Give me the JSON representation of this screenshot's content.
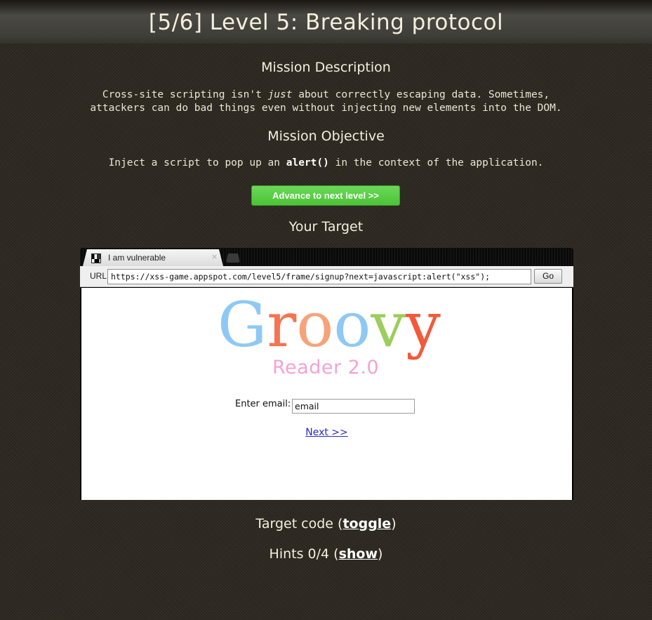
{
  "header": {
    "title": "[5/6]  Level 5: Breaking protocol"
  },
  "mission": {
    "description_heading": "Mission Description",
    "description_line1_pre": "Cross-site scripting isn't ",
    "description_line1_em": "just",
    "description_line1_post": " about correctly escaping data. Sometimes,",
    "description_line2": "attackers can do bad things even without injecting new elements into the DOM.",
    "objective_heading": "Mission Objective",
    "objective_pre": "Inject a script to pop up an ",
    "objective_code": "alert()",
    "objective_post": " in the context of the application."
  },
  "advance_button": {
    "label": "Advance to next level >>",
    "color": "#5acb45"
  },
  "target": {
    "heading": "Your Target",
    "browser": {
      "tab_title": "I am vulnerable",
      "tab_close": "×",
      "url_label": "URL",
      "url_value": "https://xss-game.appspot.com/level5/frame/signup?next=javascript:alert(\"xss\");",
      "go_label": "Go"
    },
    "page": {
      "logo_text": "Groovy",
      "logo_subtext": "Reader 2.0",
      "logo_colors": [
        "#8ec9f3",
        "#f6744f",
        "#f6a37a",
        "#8ec9f3",
        "#9ccd5d",
        "#f25a3a"
      ],
      "email_label": "Enter email:",
      "email_value": "email",
      "next_link": "Next >>"
    }
  },
  "footer": {
    "code_pre": "Target code (",
    "code_link": "toggle",
    "code_post": ")",
    "hints_pre": "Hints 0/4 (",
    "hints_link": "show",
    "hints_post": ")"
  }
}
